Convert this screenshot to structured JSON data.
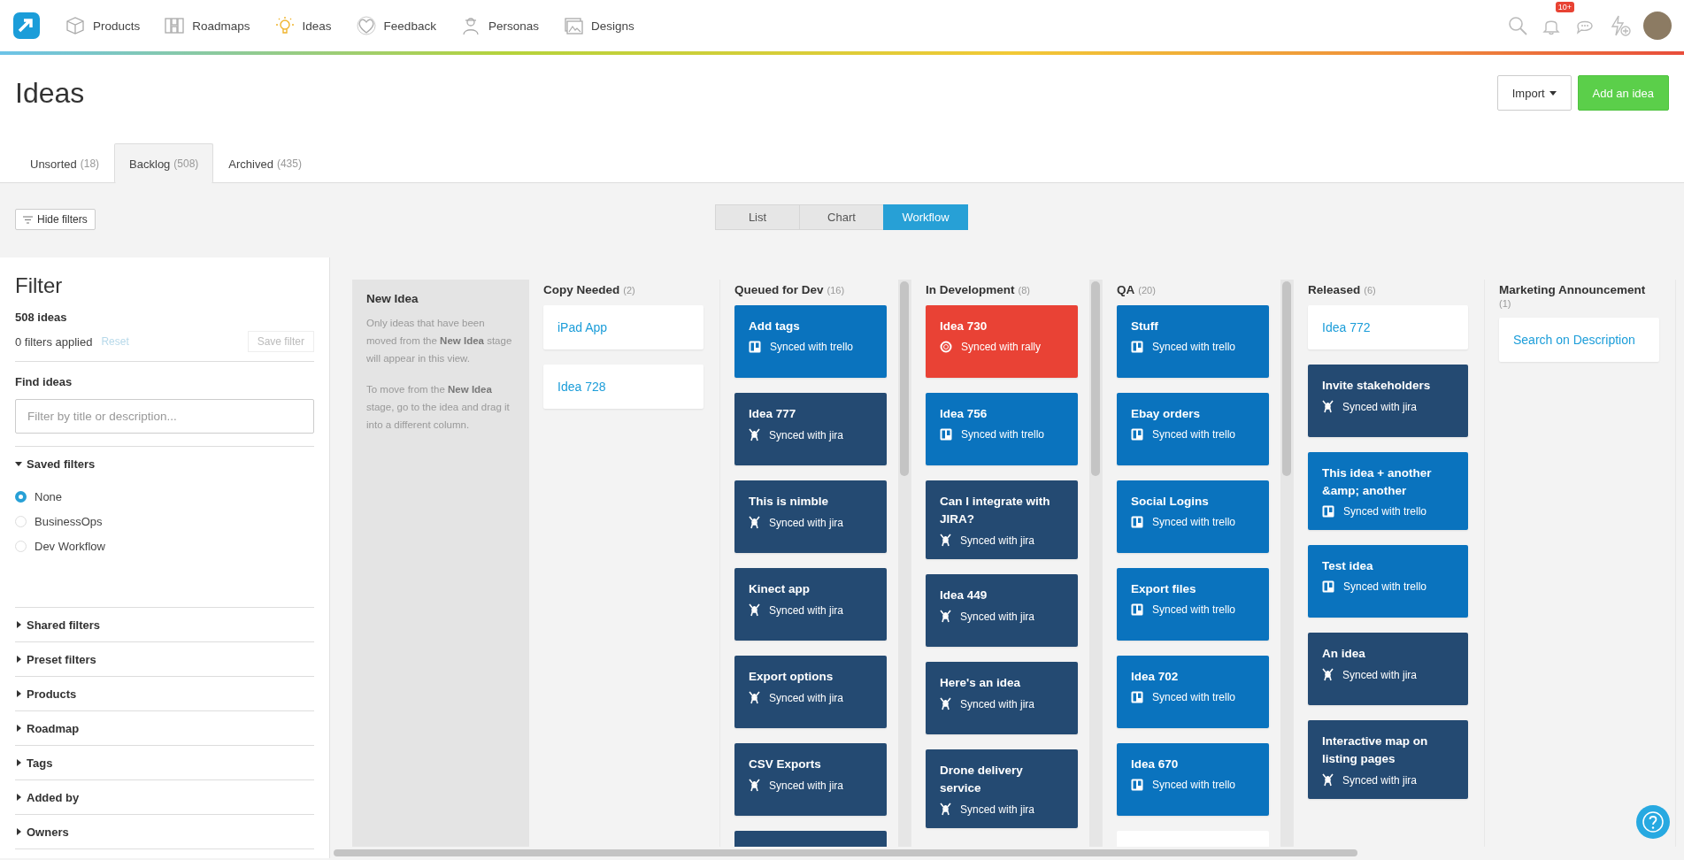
{
  "nav": {
    "items": [
      {
        "label": "Products",
        "kind": "box"
      },
      {
        "label": "Roadmaps",
        "kind": "grid"
      },
      {
        "label": "Ideas",
        "kind": "bulb"
      },
      {
        "label": "Feedback",
        "kind": "heart"
      },
      {
        "label": "Personas",
        "kind": "person"
      },
      {
        "label": "Designs",
        "kind": "image"
      }
    ],
    "notification_badge": "10+"
  },
  "page": {
    "title": "Ideas",
    "import_button": "Import",
    "add_button": "Add an idea"
  },
  "tabs": [
    {
      "label": "Unsorted",
      "count": "(18)",
      "selected": false
    },
    {
      "label": "Backlog",
      "count": "(508)",
      "selected": true
    },
    {
      "label": "Archived",
      "count": "(435)",
      "selected": false
    }
  ],
  "hide_filters_button": "Hide filters",
  "views": [
    {
      "label": "List",
      "selected": false
    },
    {
      "label": "Chart",
      "selected": false
    },
    {
      "label": "Workflow",
      "selected": true
    }
  ],
  "sidebar": {
    "title": "Filter",
    "idea_count": "508 ideas",
    "filters_applied": "0 filters applied",
    "reset_link": "Reset",
    "save_filter_button": "Save filter",
    "find_label": "Find ideas",
    "search_placeholder": "Filter by title or description...",
    "saved_filters": {
      "label": "Saved filters",
      "expanded": true,
      "options": [
        {
          "label": "None",
          "selected": true
        },
        {
          "label": "BusinessOps",
          "selected": false
        },
        {
          "label": "Dev Workflow",
          "selected": false
        }
      ]
    },
    "sections": [
      {
        "label": "Shared filters",
        "expanded": false
      },
      {
        "label": "Preset filters",
        "expanded": false
      },
      {
        "label": "Products",
        "expanded": false
      },
      {
        "label": "Roadmap",
        "expanded": false
      },
      {
        "label": "Tags",
        "expanded": false
      },
      {
        "label": "Added by",
        "expanded": false
      },
      {
        "label": "Owners",
        "expanded": false
      }
    ]
  },
  "new_idea_column": {
    "title": "New Idea",
    "paragraphs": [
      "Only ideas that have been moved from the **New Idea** stage will appear in this view.",
      "To move from the **New Idea** stage, go to the idea and drag it into a different column."
    ]
  },
  "columns": [
    {
      "name": "Copy Needed",
      "count": "(2)",
      "scrollable": false,
      "cards": [
        {
          "title": "iPad App",
          "kind": "plain"
        },
        {
          "title": "Idea 728",
          "kind": "plain"
        }
      ]
    },
    {
      "name": "Queued for Dev",
      "count": "(16)",
      "scrollable": true,
      "peek": {
        "kind": "jira"
      },
      "cards": [
        {
          "title": "Add tags",
          "kind": "trello",
          "sync_text": "Synced with trello"
        },
        {
          "title": "Idea 777",
          "kind": "jira",
          "sync_text": "Synced with jira"
        },
        {
          "title": "This is nimble",
          "kind": "jira",
          "sync_text": "Synced with jira"
        },
        {
          "title": "Kinect app",
          "kind": "jira",
          "sync_text": "Synced with jira"
        },
        {
          "title": "Export options",
          "kind": "jira",
          "sync_text": "Synced with jira"
        },
        {
          "title": "CSV Exports",
          "kind": "jira",
          "sync_text": "Synced with jira"
        }
      ]
    },
    {
      "name": "In Development",
      "count": "(8)",
      "scrollable": true,
      "cards": [
        {
          "title": "Idea 730",
          "kind": "rally",
          "sync_text": "Synced with rally"
        },
        {
          "title": "Idea 756",
          "kind": "trello",
          "sync_text": "Synced with trello"
        },
        {
          "title": "Can I integrate with JIRA?",
          "kind": "jira",
          "sync_text": "Synced with jira"
        },
        {
          "title": "Idea 449",
          "kind": "jira",
          "sync_text": "Synced with jira"
        },
        {
          "title": "Here's an idea",
          "kind": "jira",
          "sync_text": "Synced with jira"
        },
        {
          "title": "Drone delivery service",
          "kind": "jira",
          "sync_text": "Synced with jira"
        }
      ]
    },
    {
      "name": "QA",
      "count": "(20)",
      "scrollable": true,
      "peek": {
        "kind": "plain"
      },
      "cards": [
        {
          "title": "Stuff",
          "kind": "trello",
          "sync_text": "Synced with trello"
        },
        {
          "title": "Ebay orders",
          "kind": "trello",
          "sync_text": "Synced with trello"
        },
        {
          "title": "Social Logins",
          "kind": "trello",
          "sync_text": "Synced with trello"
        },
        {
          "title": "Export files",
          "kind": "trello",
          "sync_text": "Synced with trello"
        },
        {
          "title": "Idea 702",
          "kind": "trello",
          "sync_text": "Synced with trello"
        },
        {
          "title": "Idea 670",
          "kind": "trello",
          "sync_text": "Synced with trello"
        }
      ]
    },
    {
      "name": "Released",
      "count": "(6)",
      "scrollable": false,
      "cards": [
        {
          "title": "Idea 772",
          "kind": "plain"
        },
        {
          "title": "Invite stakeholders",
          "kind": "jira",
          "sync_text": "Synced with jira"
        },
        {
          "title": "This idea + another &amp; another",
          "kind": "trello",
          "sync_text": "Synced with trello"
        },
        {
          "title": "Test idea",
          "kind": "trello",
          "sync_text": "Synced with trello"
        },
        {
          "title": "An idea",
          "kind": "jira",
          "sync_text": "Synced with jira"
        },
        {
          "title": "Interactive map on listing pages",
          "kind": "jira",
          "sync_text": "Synced with jira"
        }
      ]
    },
    {
      "name": "Marketing Announcement",
      "count": "(1)",
      "scrollable": false,
      "cards": [
        {
          "title": "Search on Description",
          "kind": "plain"
        }
      ]
    }
  ]
}
